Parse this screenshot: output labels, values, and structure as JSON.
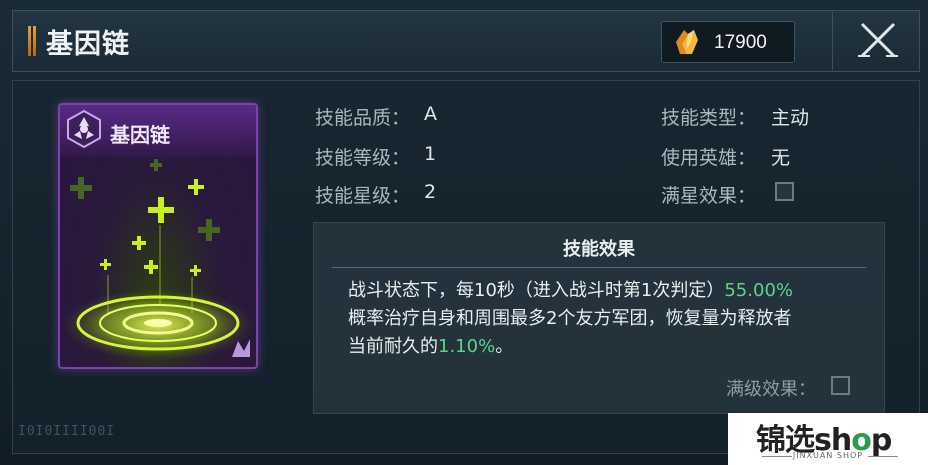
{
  "header": {
    "title": "基因链",
    "currency_icon": "crystal-icon",
    "currency_value": "17900",
    "close_icon": "close-icon"
  },
  "card": {
    "title": "基因链",
    "badge_icon": "radiation-icon",
    "corner_icon": "rank-icon"
  },
  "stats": {
    "quality_label": "技能品质：",
    "quality_value": "A",
    "level_label": "技能等级：",
    "level_value": "1",
    "star_label": "技能星级：",
    "star_value": "2",
    "type_label": "技能类型：",
    "type_value": "主动",
    "hero_label": "使用英雄：",
    "hero_value": "无",
    "max_star_label": "满星效果："
  },
  "effect": {
    "title": "技能效果",
    "text_1": "战斗状态下，每10秒（进入战斗时第1次判定）",
    "text_1_hl": "55.00%",
    "text_2": "概率治疗自身和周围最多2个友方军团，恢复量为释放者",
    "text_3": "当前耐久的",
    "text_3_hl": "1.10%",
    "text_3_end": "。",
    "max_level_label": "满级效果："
  },
  "footer": {
    "code": "I0I0IIII00I"
  },
  "watermark": {
    "brand_a": "锦选sh",
    "brand_o": "o",
    "brand_b": "p",
    "sub": "JINXUAN SHOP"
  },
  "colors": {
    "highlight": "#5ed28a",
    "card_border": "#7a44a8",
    "accent": "#e8a030"
  }
}
